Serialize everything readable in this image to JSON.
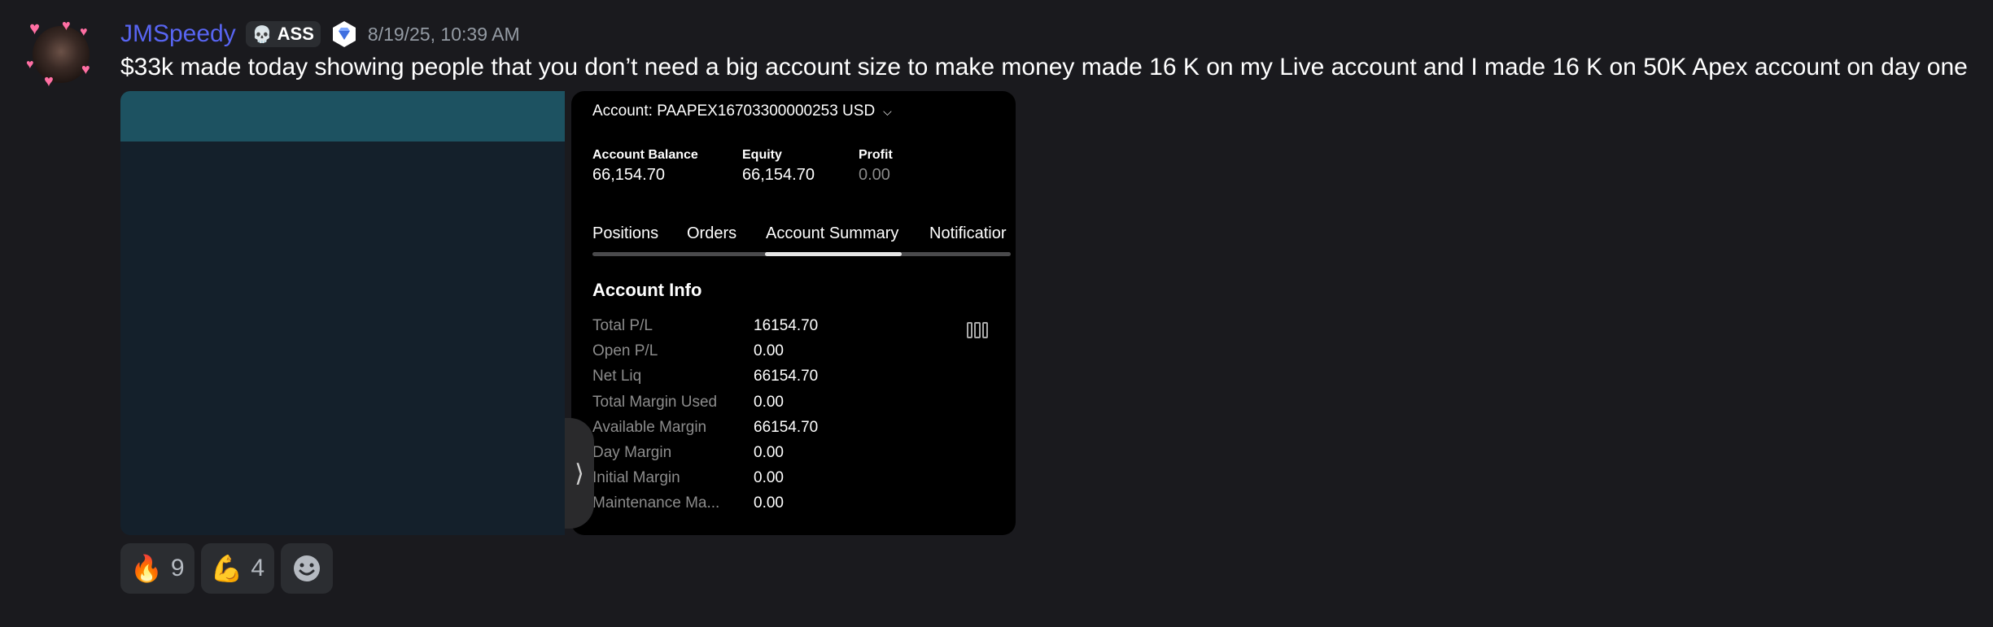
{
  "message": {
    "username": "JMSpeedy",
    "role_tag": "ASS",
    "timestamp": "8/19/25, 10:39 AM",
    "text": "$33k made today showing people that you don’t need a big account size to make money made 16 K on my Live account and I made 16 K on 50K Apex account on day one",
    "avatar_icon": "user-avatar",
    "accent_color": "#5865f2"
  },
  "screenshot": {
    "account_line": "Account: PAAPEX16703300000253 USD",
    "metrics": [
      {
        "label": "Account Balance",
        "value": "66,154.70"
      },
      {
        "label": "Equity",
        "value": "66,154.70"
      },
      {
        "label": "Profit",
        "value": "0.00"
      }
    ],
    "tabs": [
      {
        "label": "Positions"
      },
      {
        "label": "Orders"
      },
      {
        "label": "Account Summary"
      },
      {
        "label": "Notificatior"
      }
    ],
    "active_tab": "Account Summary",
    "info_title": "Account Info",
    "info_rows": [
      {
        "label": "Total P/L",
        "value": "16154.70"
      },
      {
        "label": "Open P/L",
        "value": "0.00"
      },
      {
        "label": "Net Liq",
        "value": "66154.70"
      },
      {
        "label": "Total Margin Used",
        "value": "0.00"
      },
      {
        "label": "Available Margin",
        "value": "66154.70"
      },
      {
        "label": "Day Margin",
        "value": "0.00"
      },
      {
        "label": "Initial Margin",
        "value": "0.00"
      },
      {
        "label": "Maintenance Ma...",
        "value": "0.00"
      }
    ]
  },
  "reactions": [
    {
      "emoji": "🔥",
      "count": "9"
    },
    {
      "emoji": "💪",
      "count": "4"
    }
  ]
}
